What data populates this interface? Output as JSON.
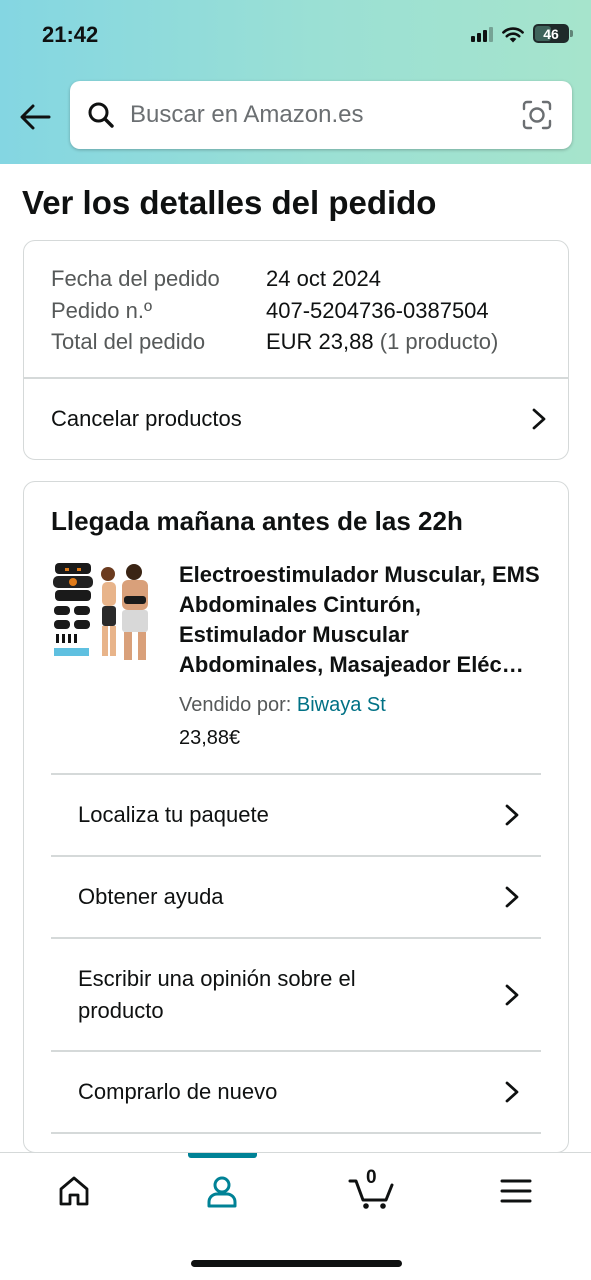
{
  "status_bar": {
    "time": "21:42",
    "battery": "46",
    "icons": [
      "cellular-signal-icon",
      "wifi-icon",
      "battery-icon"
    ]
  },
  "search": {
    "placeholder": "Buscar en Amazon.es",
    "icons": [
      "back-arrow-icon",
      "search-icon",
      "camera-lens-icon"
    ]
  },
  "page": {
    "title": "Ver los detalles del pedido"
  },
  "order_summary": {
    "rows": [
      {
        "label": "Fecha del pedido",
        "value": "24 oct 2024",
        "extra": ""
      },
      {
        "label": "Pedido n.º",
        "value": "407-5204736-0387504",
        "extra": ""
      },
      {
        "label": "Total del pedido",
        "value": "EUR 23,88",
        "extra": "(1 producto)"
      }
    ],
    "cancel_label": "Cancelar productos"
  },
  "shipment": {
    "arrival": "Llegada mañana antes de las 22h",
    "product_title": "Electroestimulador Muscular, EMS Abdominales Cinturón, Estimulador Muscular Abdominales, Masajeador Eléc…",
    "sold_by_label": "Vendido por:",
    "seller": "Biwaya St",
    "price": "23,88€",
    "actions": [
      "Localiza tu paquete",
      "Obtener ayuda",
      "Escribir una opinión sobre el producto",
      "Comprarlo de nuevo"
    ]
  },
  "bottom_nav": {
    "items": [
      "home-icon",
      "account-icon",
      "cart-icon",
      "menu-icon"
    ],
    "active": "account-icon",
    "cart_count": "0"
  },
  "colors": {
    "header_gradient": [
      "#84d6e2",
      "#a6e4cc"
    ],
    "link": "#007185",
    "accent": "#008296",
    "text": "#0f1111",
    "secondary_text": "#565959",
    "border": "#d5d9d9"
  }
}
